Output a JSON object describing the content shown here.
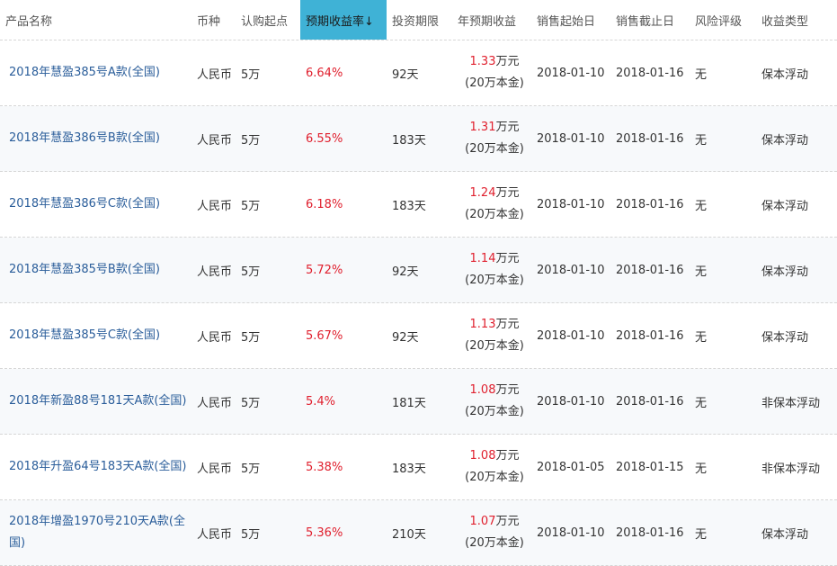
{
  "sort_arrow": "↓",
  "colors": {
    "link": "#2a5d9a",
    "rate": "#e0202e",
    "header_active": "#3fb2d6"
  },
  "headers": [
    {
      "label": "产品名称"
    },
    {
      "label": "币种"
    },
    {
      "label": "认购起点"
    },
    {
      "label": "预期收益率↓"
    },
    {
      "label": "投资期限"
    },
    {
      "label": "年预期收益"
    },
    {
      "label": "销售起始日"
    },
    {
      "label": "销售截止日"
    },
    {
      "label": "风险评级"
    },
    {
      "label": "收益类型"
    }
  ],
  "rows": [
    {
      "name": "2018年慧盈385号A款(全国)",
      "currency": "人民币",
      "min_purchase": "5万",
      "rate": "6.64%",
      "term": "92天",
      "annual_value": "1.33",
      "annual_unit": "万元",
      "annual_note": "(20万本金)",
      "start": "2018-01-10",
      "end": "2018-01-16",
      "risk": "无",
      "type": "保本浮动"
    },
    {
      "name": "2018年慧盈386号B款(全国)",
      "currency": "人民币",
      "min_purchase": "5万",
      "rate": "6.55%",
      "term": "183天",
      "annual_value": "1.31",
      "annual_unit": "万元",
      "annual_note": "(20万本金)",
      "start": "2018-01-10",
      "end": "2018-01-16",
      "risk": "无",
      "type": "保本浮动"
    },
    {
      "name": "2018年慧盈386号C款(全国)",
      "currency": "人民币",
      "min_purchase": "5万",
      "rate": "6.18%",
      "term": "183天",
      "annual_value": "1.24",
      "annual_unit": "万元",
      "annual_note": "(20万本金)",
      "start": "2018-01-10",
      "end": "2018-01-16",
      "risk": "无",
      "type": "保本浮动"
    },
    {
      "name": "2018年慧盈385号B款(全国)",
      "currency": "人民币",
      "min_purchase": "5万",
      "rate": "5.72%",
      "term": "92天",
      "annual_value": "1.14",
      "annual_unit": "万元",
      "annual_note": "(20万本金)",
      "start": "2018-01-10",
      "end": "2018-01-16",
      "risk": "无",
      "type": "保本浮动"
    },
    {
      "name": "2018年慧盈385号C款(全国)",
      "currency": "人民币",
      "min_purchase": "5万",
      "rate": "5.67%",
      "term": "92天",
      "annual_value": "1.13",
      "annual_unit": "万元",
      "annual_note": "(20万本金)",
      "start": "2018-01-10",
      "end": "2018-01-16",
      "risk": "无",
      "type": "保本浮动"
    },
    {
      "name": "2018年新盈88号181天A款(全国)",
      "currency": "人民币",
      "min_purchase": "5万",
      "rate": "5.4%",
      "term": "181天",
      "annual_value": "1.08",
      "annual_unit": "万元",
      "annual_note": "(20万本金)",
      "start": "2018-01-10",
      "end": "2018-01-16",
      "risk": "无",
      "type": "非保本浮动"
    },
    {
      "name": "2018年升盈64号183天A款(全国)",
      "currency": "人民币",
      "min_purchase": "5万",
      "rate": "5.38%",
      "term": "183天",
      "annual_value": "1.08",
      "annual_unit": "万元",
      "annual_note": "(20万本金)",
      "start": "2018-01-05",
      "end": "2018-01-15",
      "risk": "无",
      "type": "非保本浮动"
    },
    {
      "name": "2018年增盈1970号210天A款(全国)",
      "currency": "人民币",
      "min_purchase": "5万",
      "rate": "5.36%",
      "term": "210天",
      "annual_value": "1.07",
      "annual_unit": "万元",
      "annual_note": "(20万本金)",
      "start": "2018-01-10",
      "end": "2018-01-16",
      "risk": "无",
      "type": "保本浮动"
    }
  ]
}
